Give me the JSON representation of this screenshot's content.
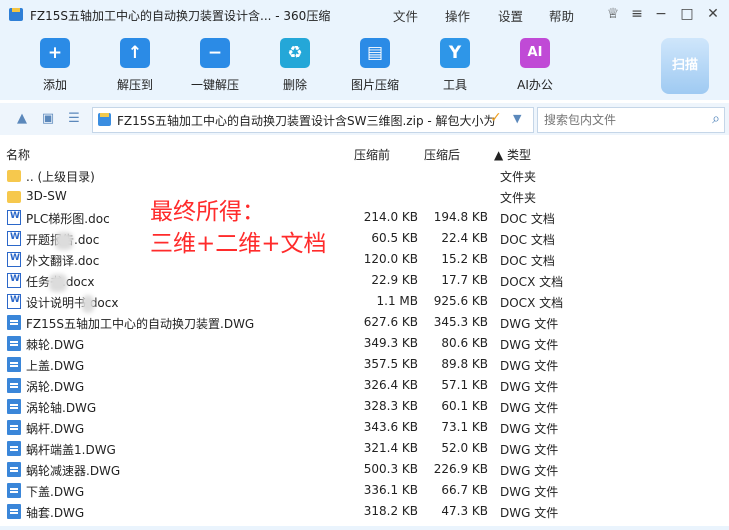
{
  "window": {
    "title": "FZ15S五轴加工中心的自动换刀装置设计含... - 360压缩",
    "menu": [
      "文件",
      "操作",
      "设置",
      "帮助"
    ]
  },
  "toolbar": {
    "items": [
      {
        "label": "添加",
        "icon": "add-icon",
        "color": "#2b8be6",
        "glyph": "+"
      },
      {
        "label": "解压到",
        "icon": "extract-icon",
        "color": "#2b8be6",
        "glyph": "↑"
      },
      {
        "label": "一键解压",
        "icon": "one-click-extract-icon",
        "color": "#2b8be6",
        "glyph": "−"
      },
      {
        "label": "删除",
        "icon": "delete-icon",
        "color": "#24a7d8",
        "glyph": "♻"
      },
      {
        "label": "图片压缩",
        "icon": "image-compress-icon",
        "color": "#2b8be6",
        "glyph": "▤"
      },
      {
        "label": "工具",
        "icon": "tools-icon",
        "color": "#2e96e8",
        "glyph": "Y"
      },
      {
        "label": "AI办公",
        "icon": "ai-office-icon",
        "color": "#c04ad6",
        "glyph": "AI"
      }
    ],
    "scan_label": "扫描"
  },
  "pathbar": {
    "path": "FZ15S五轴加工中心的自动换刀装置设计含SW三维图.zip - 解包大小为",
    "search_placeholder": "搜索包内文件"
  },
  "columns": {
    "name": "名称",
    "compressed": "压缩前",
    "original": "压缩后",
    "type": "▲ 类型"
  },
  "files": [
    {
      "name": ".. (上级目录)",
      "compressed": "",
      "original": "",
      "type": "文件夹",
      "icon": "folder"
    },
    {
      "name": "3D-SW",
      "compressed": "",
      "original": "",
      "type": "文件夹",
      "icon": "folder"
    },
    {
      "name": "PLC梯形图.doc",
      "compressed": "214.0 KB",
      "original": "194.8 KB",
      "type": "DOC 文档",
      "icon": "doc"
    },
    {
      "name": "开题报告.doc",
      "compressed": "60.5 KB",
      "original": "22.4 KB",
      "type": "DOC 文档",
      "icon": "doc"
    },
    {
      "name": "外文翻译.doc",
      "compressed": "120.0 KB",
      "original": "15.2 KB",
      "type": "DOC 文档",
      "icon": "doc"
    },
    {
      "name": "任务书.docx",
      "compressed": "22.9 KB",
      "original": "17.7 KB",
      "type": "DOCX 文档",
      "icon": "doc"
    },
    {
      "name": "设计说明书.docx",
      "compressed": "1.1 MB",
      "original": "925.6 KB",
      "type": "DOCX 文档",
      "icon": "doc"
    },
    {
      "name": "FZ15S五轴加工中心的自动换刀装置.DWG",
      "compressed": "627.6 KB",
      "original": "345.3 KB",
      "type": "DWG 文件",
      "icon": "dwg"
    },
    {
      "name": "棘轮.DWG",
      "compressed": "349.3 KB",
      "original": "80.6 KB",
      "type": "DWG 文件",
      "icon": "dwg"
    },
    {
      "name": "上盖.DWG",
      "compressed": "357.5 KB",
      "original": "89.8 KB",
      "type": "DWG 文件",
      "icon": "dwg"
    },
    {
      "name": "涡轮.DWG",
      "compressed": "326.4 KB",
      "original": "57.1 KB",
      "type": "DWG 文件",
      "icon": "dwg"
    },
    {
      "name": "涡轮轴.DWG",
      "compressed": "328.3 KB",
      "original": "60.1 KB",
      "type": "DWG 文件",
      "icon": "dwg"
    },
    {
      "name": "蜗杆.DWG",
      "compressed": "343.6 KB",
      "original": "73.1 KB",
      "type": "DWG 文件",
      "icon": "dwg"
    },
    {
      "name": "蜗杆端盖1.DWG",
      "compressed": "321.4 KB",
      "original": "52.0 KB",
      "type": "DWG 文件",
      "icon": "dwg"
    },
    {
      "name": "蜗轮减速器.DWG",
      "compressed": "500.3 KB",
      "original": "226.9 KB",
      "type": "DWG 文件",
      "icon": "dwg"
    },
    {
      "name": "下盖.DWG",
      "compressed": "336.1 KB",
      "original": "66.7 KB",
      "type": "DWG 文件",
      "icon": "dwg"
    },
    {
      "name": "轴套.DWG",
      "compressed": "318.2 KB",
      "original": "47.3 KB",
      "type": "DWG 文件",
      "icon": "dwg"
    }
  ],
  "overlay": {
    "line1": "最终所得：",
    "line2": "三维+二维+文档"
  }
}
